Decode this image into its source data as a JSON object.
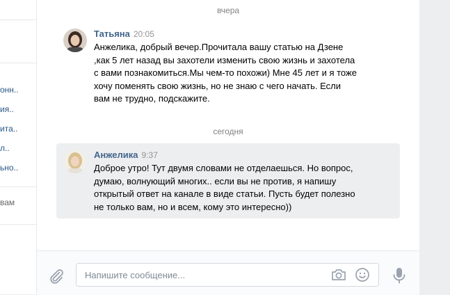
{
  "sidebar": {
    "items": [
      {
        "label": "онн.."
      },
      {
        "label": "ия.."
      },
      {
        "label": "ита.."
      },
      {
        "label": "л.."
      },
      {
        "label": "ьно.."
      },
      {
        "label": "вам"
      }
    ]
  },
  "chat": {
    "date_yesterday": "вчера",
    "date_today": "сегодня",
    "messages": [
      {
        "author": "Татьяна",
        "time": "20:05",
        "lines": [
          "Анжелика, добрый вечер.Прочитала вашу статью на Дзене",
          ",как 5 лет назад вы захотели изменить свою жизнь и захотела",
          "с вами познакомиться.Мы чем-то похожи) Мне 45 лет и я тоже",
          "хочу поменять свою жизнь, но не знаю с чего начать. Если",
          "вам не трудно, подскажите."
        ]
      },
      {
        "author": "Анжелика",
        "time": "9:37",
        "lines": [
          "Доброе утро! Тут двумя словами не отделаешься. Но вопрос,",
          "думаю, волнующий многих.. если вы не против, я напишу",
          "открытый ответ на канале в виде статьи. Пусть будет полезно",
          "не только вам, но и всем, кому это интересно))"
        ]
      }
    ]
  },
  "composer": {
    "placeholder": "Напишите сообщение...",
    "value": ""
  },
  "icons": {
    "attach": "paperclip-icon",
    "camera": "camera-icon",
    "emoji": "smile-icon",
    "voice": "microphone-icon"
  },
  "colors": {
    "author": "#42648b",
    "highlight": "#edeef0",
    "icon": "#99a2ad"
  }
}
